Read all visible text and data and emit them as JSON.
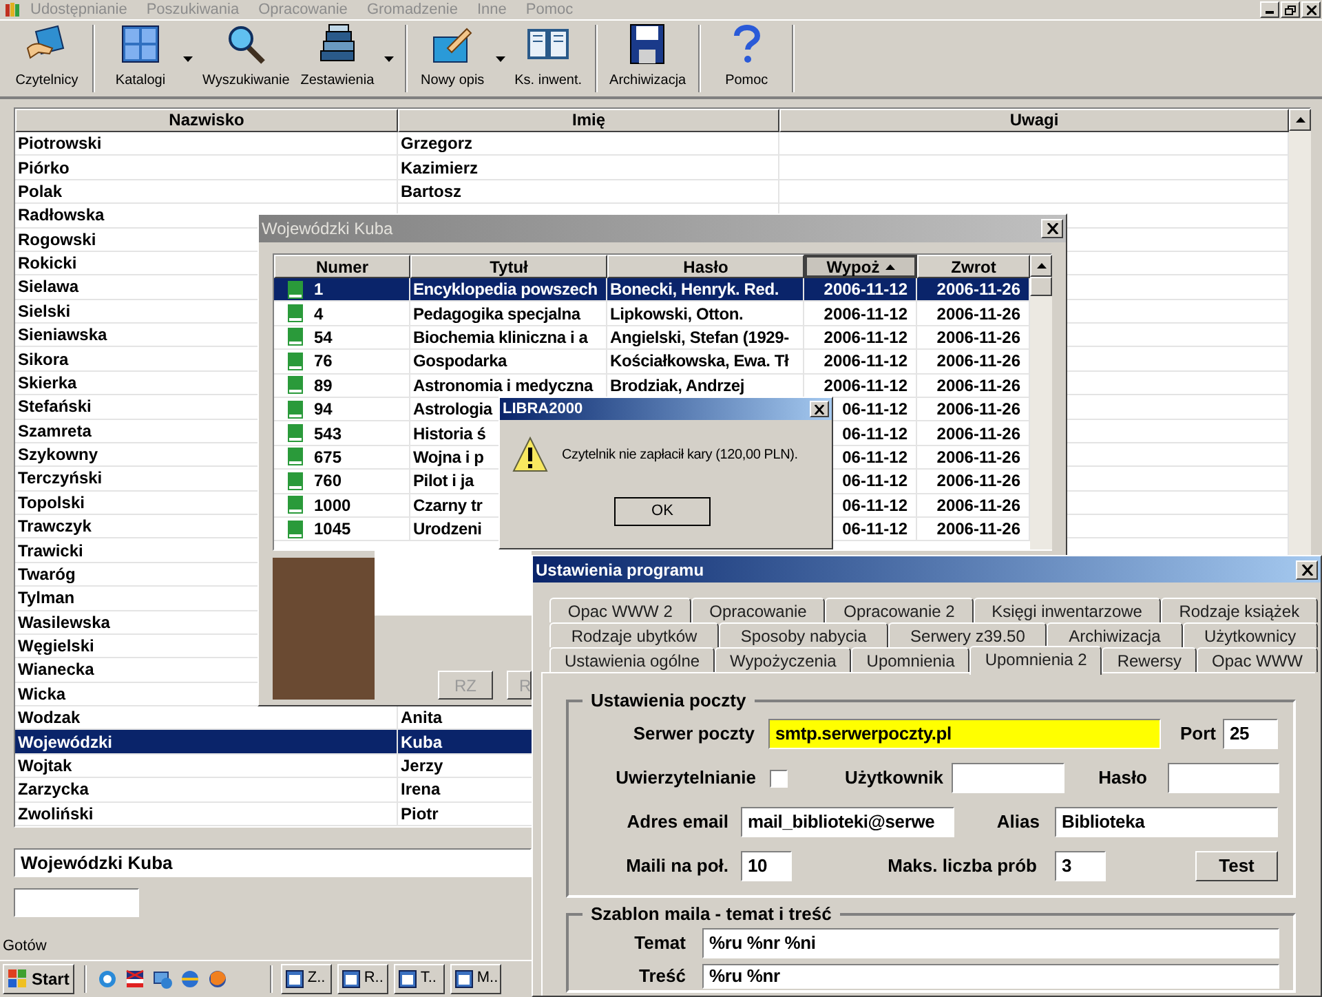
{
  "menu": [
    {
      "label": "Udostępnianie",
      "disabled": true
    },
    {
      "label": "Poszukiwania",
      "disabled": true
    },
    {
      "label": "Opracowanie",
      "disabled": true
    },
    {
      "label": "Gromadzenie",
      "disabled": true
    },
    {
      "label": "Inne",
      "disabled": true
    },
    {
      "label": "Pomoc",
      "disabled": true
    }
  ],
  "toolbar": [
    {
      "label": "Czytelnicy",
      "kind": "readers",
      "dropdown": false,
      "separator": true
    },
    {
      "label": "Katalogi",
      "kind": "catalogs",
      "dropdown": true,
      "separator": false
    },
    {
      "label": "Wyszukiwanie",
      "kind": "search",
      "dropdown": false,
      "separator": false
    },
    {
      "label": "Zestawienia",
      "kind": "reports",
      "dropdown": true,
      "separator": true
    },
    {
      "label": "Nowy opis",
      "kind": "new_record",
      "dropdown": true,
      "separator": false
    },
    {
      "label": "Ks. inwent.",
      "kind": "inventory",
      "dropdown": false,
      "separator": true
    },
    {
      "label": "Archiwizacja",
      "kind": "archive",
      "dropdown": false,
      "separator": true
    },
    {
      "label": "Pomoc",
      "kind": "help",
      "dropdown": false,
      "separator": true
    }
  ],
  "readers_table": {
    "columns": [
      "Nazwisko",
      "Imię",
      "Uwagi"
    ],
    "rows": [
      {
        "surname": "Piotrowski",
        "first_name": "Grzegorz",
        "selected": false
      },
      {
        "surname": "Piórko",
        "first_name": "Kazimierz",
        "selected": false
      },
      {
        "surname": "Polak",
        "first_name": "Bartosz",
        "selected": false
      },
      {
        "surname": "Radłowska",
        "selected": false
      },
      {
        "surname": "Rogowski",
        "selected": false
      },
      {
        "surname": "Rokicki",
        "selected": false
      },
      {
        "surname": "Sielawa",
        "selected": false
      },
      {
        "surname": "Sielski",
        "selected": false
      },
      {
        "surname": "Sieniawska",
        "selected": false
      },
      {
        "surname": "Sikora",
        "selected": false
      },
      {
        "surname": "Skierka",
        "selected": false
      },
      {
        "surname": "Stefański",
        "selected": false
      },
      {
        "surname": "Szamreta",
        "selected": false
      },
      {
        "surname": "Szykowny",
        "selected": false
      },
      {
        "surname": "Terczyński",
        "selected": false
      },
      {
        "surname": "Topolski",
        "selected": false
      },
      {
        "surname": "Trawczyk",
        "selected": false
      },
      {
        "surname": "Trawicki",
        "selected": false
      },
      {
        "surname": "Twaróg",
        "selected": false
      },
      {
        "surname": "Tylman",
        "selected": false
      },
      {
        "surname": "Wasilewska",
        "selected": false
      },
      {
        "surname": "Węgielski",
        "selected": false
      },
      {
        "surname": "Wianecka",
        "selected": false
      },
      {
        "surname": "Wicka",
        "selected": false
      },
      {
        "surname": "Wodzak",
        "first_name": "Anita",
        "selected": false
      },
      {
        "surname": "Wojewódzki",
        "first_name": "Kuba",
        "selected": true
      },
      {
        "surname": "Wojtak",
        "first_name": "Jerzy",
        "selected": false
      },
      {
        "surname": "Zarzycka",
        "first_name": "Irena",
        "selected": false
      },
      {
        "surname": "Zwoliński",
        "first_name": "Piotr",
        "selected": false
      }
    ]
  },
  "name_field": {
    "value": "Wojewódzki Kuba"
  },
  "status_bar": "Gotów",
  "taskbar": {
    "start": "Start",
    "tasks": [
      "Z..",
      "R..",
      "T..",
      "M.."
    ]
  },
  "loans_window": {
    "title": "Wojewódzki Kuba",
    "columns": [
      {
        "label": "Numer",
        "sorted": false
      },
      {
        "label": "Tytuł",
        "sorted": false
      },
      {
        "label": "Hasło",
        "sorted": false
      },
      {
        "label": "Wypoż",
        "sorted": true
      },
      {
        "label": "Zwrot",
        "sorted": false
      }
    ],
    "rows": [
      {
        "number": "1",
        "title": "Encyklopedia powszech",
        "entry": "Bonecki, Henryk. Red.",
        "loan_date": "2006-11-12",
        "return_date": "2006-11-26",
        "selected": true
      },
      {
        "number": "4",
        "title": "Pedagogika specjalna",
        "entry": "Lipkowski, Otton.",
        "loan_date": "2006-11-12",
        "return_date": "2006-11-26",
        "selected": false
      },
      {
        "number": "54",
        "title": "Biochemia kliniczna i a",
        "entry": "Angielski, Stefan (1929-",
        "loan_date": "2006-11-12",
        "return_date": "2006-11-26",
        "selected": false
      },
      {
        "number": "76",
        "title": "Gospodarka",
        "entry": "Kościałkowska, Ewa. Tł",
        "loan_date": "2006-11-12",
        "return_date": "2006-11-26",
        "selected": false
      },
      {
        "number": "89",
        "title": "Astronomia i medyczna",
        "entry": "Brodziak, Andrzej",
        "loan_date": "2006-11-12",
        "return_date": "2006-11-26",
        "selected": false
      },
      {
        "number": "94",
        "title": "Astrologia",
        "loan_date": "06-11-12",
        "return_date": "2006-11-26",
        "selected": false
      },
      {
        "number": "543",
        "title": "Historia ś",
        "loan_date": "06-11-12",
        "return_date": "2006-11-26",
        "selected": false
      },
      {
        "number": "675",
        "title": "Wojna i p",
        "loan_date": "06-11-12",
        "return_date": "2006-11-26",
        "selected": false
      },
      {
        "number": "760",
        "title": "Pilot i ja",
        "loan_date": "06-11-12",
        "return_date": "2006-11-26",
        "selected": false
      },
      {
        "number": "1000",
        "title": "Czarny tr",
        "loan_date": "06-11-12",
        "return_date": "2006-11-26",
        "selected": false
      },
      {
        "number": "1045",
        "title": "Urodzeni",
        "loan_date": "06-11-12",
        "return_date": "2006-11-26",
        "selected": false
      }
    ],
    "buttons": [
      {
        "label": "RZ",
        "disabled": true
      },
      {
        "label": "R",
        "disabled": true
      }
    ]
  },
  "alert": {
    "title": "LIBRA2000",
    "message": "Czytelnik nie zapłacił kary (120,00 PLN).",
    "button": "OK"
  },
  "settings_window": {
    "title": "Ustawienia programu",
    "tab_rows": [
      [
        {
          "label": "Opac WWW 2",
          "selected": false
        },
        {
          "label": "Opracowanie",
          "selected": false
        },
        {
          "label": "Opracowanie 2",
          "selected": false
        },
        {
          "label": "Księgi inwentarzowe",
          "selected": false
        },
        {
          "label": "Rodzaje książek",
          "selected": false
        }
      ],
      [
        {
          "label": "Rodzaje ubytków",
          "selected": false
        },
        {
          "label": "Sposoby nabycia",
          "selected": false
        },
        {
          "label": "Serwery z39.50",
          "selected": false
        },
        {
          "label": "Archiwizacja",
          "selected": false
        },
        {
          "label": "Użytkownicy",
          "selected": false
        }
      ],
      [
        {
          "label": "Ustawienia ogólne",
          "selected": false
        },
        {
          "label": "Wypożyczenia",
          "selected": false
        },
        {
          "label": "Upomnienia",
          "selected": false
        },
        {
          "label": "Upomnienia 2",
          "selected": true
        },
        {
          "label": "Rewersy",
          "selected": false
        },
        {
          "label": "Opac WWW",
          "selected": false
        }
      ]
    ],
    "mail_group": {
      "title": "Ustawienia poczty",
      "server": {
        "label": "Serwer poczty",
        "value": "smtp.serwerpoczty.pl",
        "focused": true
      },
      "port": {
        "label": "Port",
        "value": "25",
        "focused": false
      },
      "auth": {
        "label": "Uwierzytelnianie",
        "checked": false
      },
      "user": {
        "label": "Użytkownik",
        "focused": false
      },
      "password": {
        "label": "Hasło",
        "focused": false
      },
      "email": {
        "label": "Adres email",
        "value": "mail_biblioteki@serwe",
        "focused": false
      },
      "alias": {
        "label": "Alias",
        "value": "Biblioteka",
        "focused": false
      },
      "per_connection": {
        "label": "Maili na poł.",
        "value": "10",
        "focused": false
      },
      "max_attempts": {
        "label": "Maks. liczba prób",
        "value": "3",
        "focused": false
      },
      "test_button": "Test"
    },
    "template_group": {
      "title": "Szablon maila - temat i treść",
      "subject": {
        "label": "Temat",
        "value": "%ru %nr %ni",
        "focused": false
      },
      "body": {
        "label": "Treść",
        "value": "%ru %nr",
        "focused": false
      }
    }
  }
}
